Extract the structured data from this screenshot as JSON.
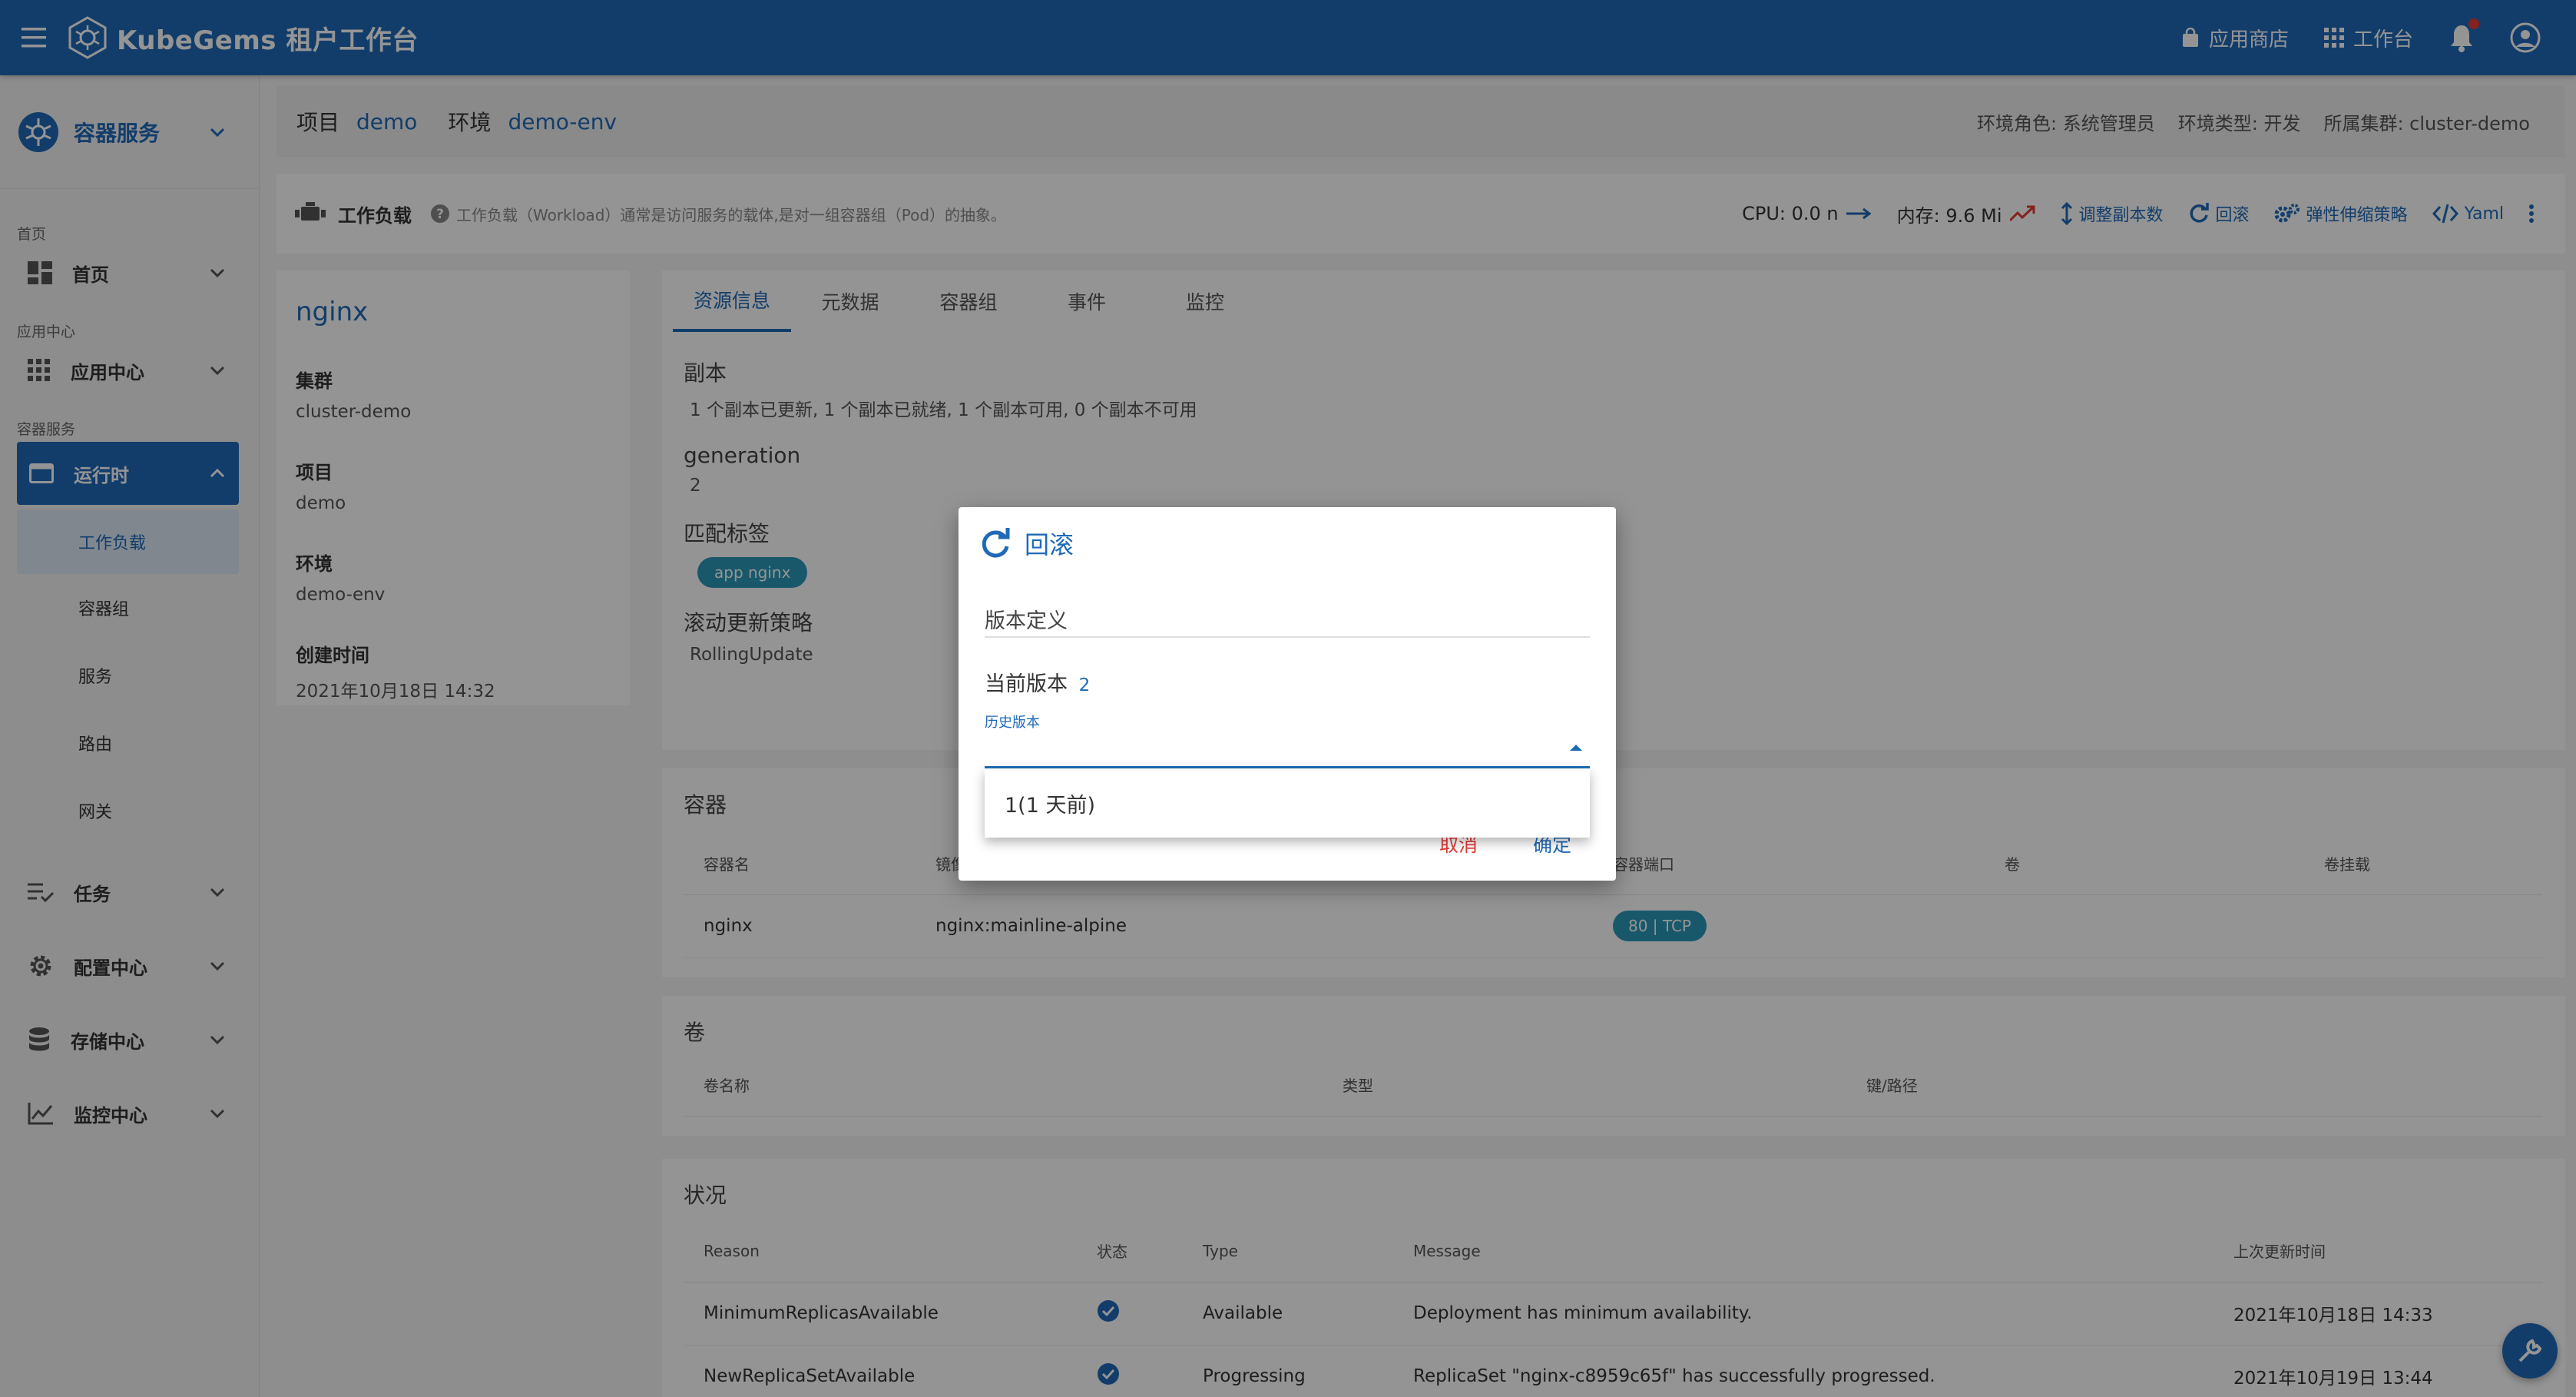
{
  "header": {
    "brand": "KubeGems 租户工作台",
    "app_store": "应用商店",
    "workspace": "工作台"
  },
  "sidebar": {
    "service_title": "容器服务",
    "home_section": "首页",
    "home": "首页",
    "app_section": "应用中心",
    "app_center": "应用中心",
    "container_section": "容器服务",
    "runtime": "运行时",
    "runtime_items": [
      "工作负载",
      "容器组",
      "服务",
      "路由",
      "网关"
    ],
    "tasks": "任务",
    "config_center": "配置中心",
    "storage_center": "存储中心",
    "monitor_center": "监控中心"
  },
  "breadcrumb": {
    "project_label": "项目",
    "project": "demo",
    "env_label": "环境",
    "env": "demo-env",
    "env_role": "环境角色: 系统管理员",
    "env_type": "环境类型: 开发",
    "cluster": "所属集群: cluster-demo"
  },
  "toolbar": {
    "title": "工作负载",
    "help": "工作负载（Workload）通常是访问服务的载体,是对一组容器组（Pod）的抽象。",
    "cpu": "CPU: 0.0 n",
    "memory": "内存: 9.6 Mi",
    "scale": "调整副本数",
    "rollback": "回滚",
    "hpa": "弹性伸缩策略",
    "yaml": "Yaml"
  },
  "workload": {
    "name": "nginx",
    "cluster_label": "集群",
    "cluster": "cluster-demo",
    "project_label": "项目",
    "project": "demo",
    "env_label": "环境",
    "env": "demo-env",
    "created_label": "创建时间",
    "created": "2021年10月18日 14:32"
  },
  "tabs": [
    "资源信息",
    "元数据",
    "容器组",
    "事件",
    "监控"
  ],
  "resource": {
    "replicas_label": "副本",
    "replicas": "1 个副本已更新, 1 个副本已就绪, 1 个副本可用, 0 个副本不可用",
    "generation_label": "generation",
    "generation": "2",
    "selector_label": "匹配标签",
    "selector_chip": "app nginx",
    "strategy_label": "滚动更新策略",
    "strategy": "RollingUpdate"
  },
  "containers": {
    "title": "容器",
    "headers": [
      "容器名",
      "镜像",
      "容器端口",
      "卷",
      "卷挂载"
    ],
    "rows": [
      {
        "name": "nginx",
        "image": "nginx:mainline-alpine",
        "port": "80 | TCP",
        "volume": "",
        "mount": ""
      }
    ]
  },
  "volumes": {
    "title": "卷",
    "headers": [
      "卷名称",
      "类型",
      "键/路径"
    ]
  },
  "conditions": {
    "title": "状况",
    "headers": [
      "Reason",
      "状态",
      "Type",
      "Message",
      "上次更新时间"
    ],
    "rows": [
      {
        "reason": "MinimumReplicasAvailable",
        "type": "Available",
        "message": "Deployment has minimum availability.",
        "time": "2021年10月18日 14:33"
      },
      {
        "reason": "NewReplicaSetAvailable",
        "type": "Progressing",
        "message": "ReplicaSet \"nginx-c8959c65f\" has successfully progressed.",
        "time": "2021年10月19日 13:44"
      }
    ]
  },
  "dialog": {
    "title": "回滚",
    "version_def": "版本定义",
    "current_label": "当前版本",
    "current": "2",
    "history_label": "历史版本",
    "option": "1(1 天前)",
    "cancel": "取消",
    "ok": "确定"
  },
  "colors": {
    "primary": "#1f6ab8",
    "chip": "#2b98b8",
    "danger": "#e53935"
  }
}
